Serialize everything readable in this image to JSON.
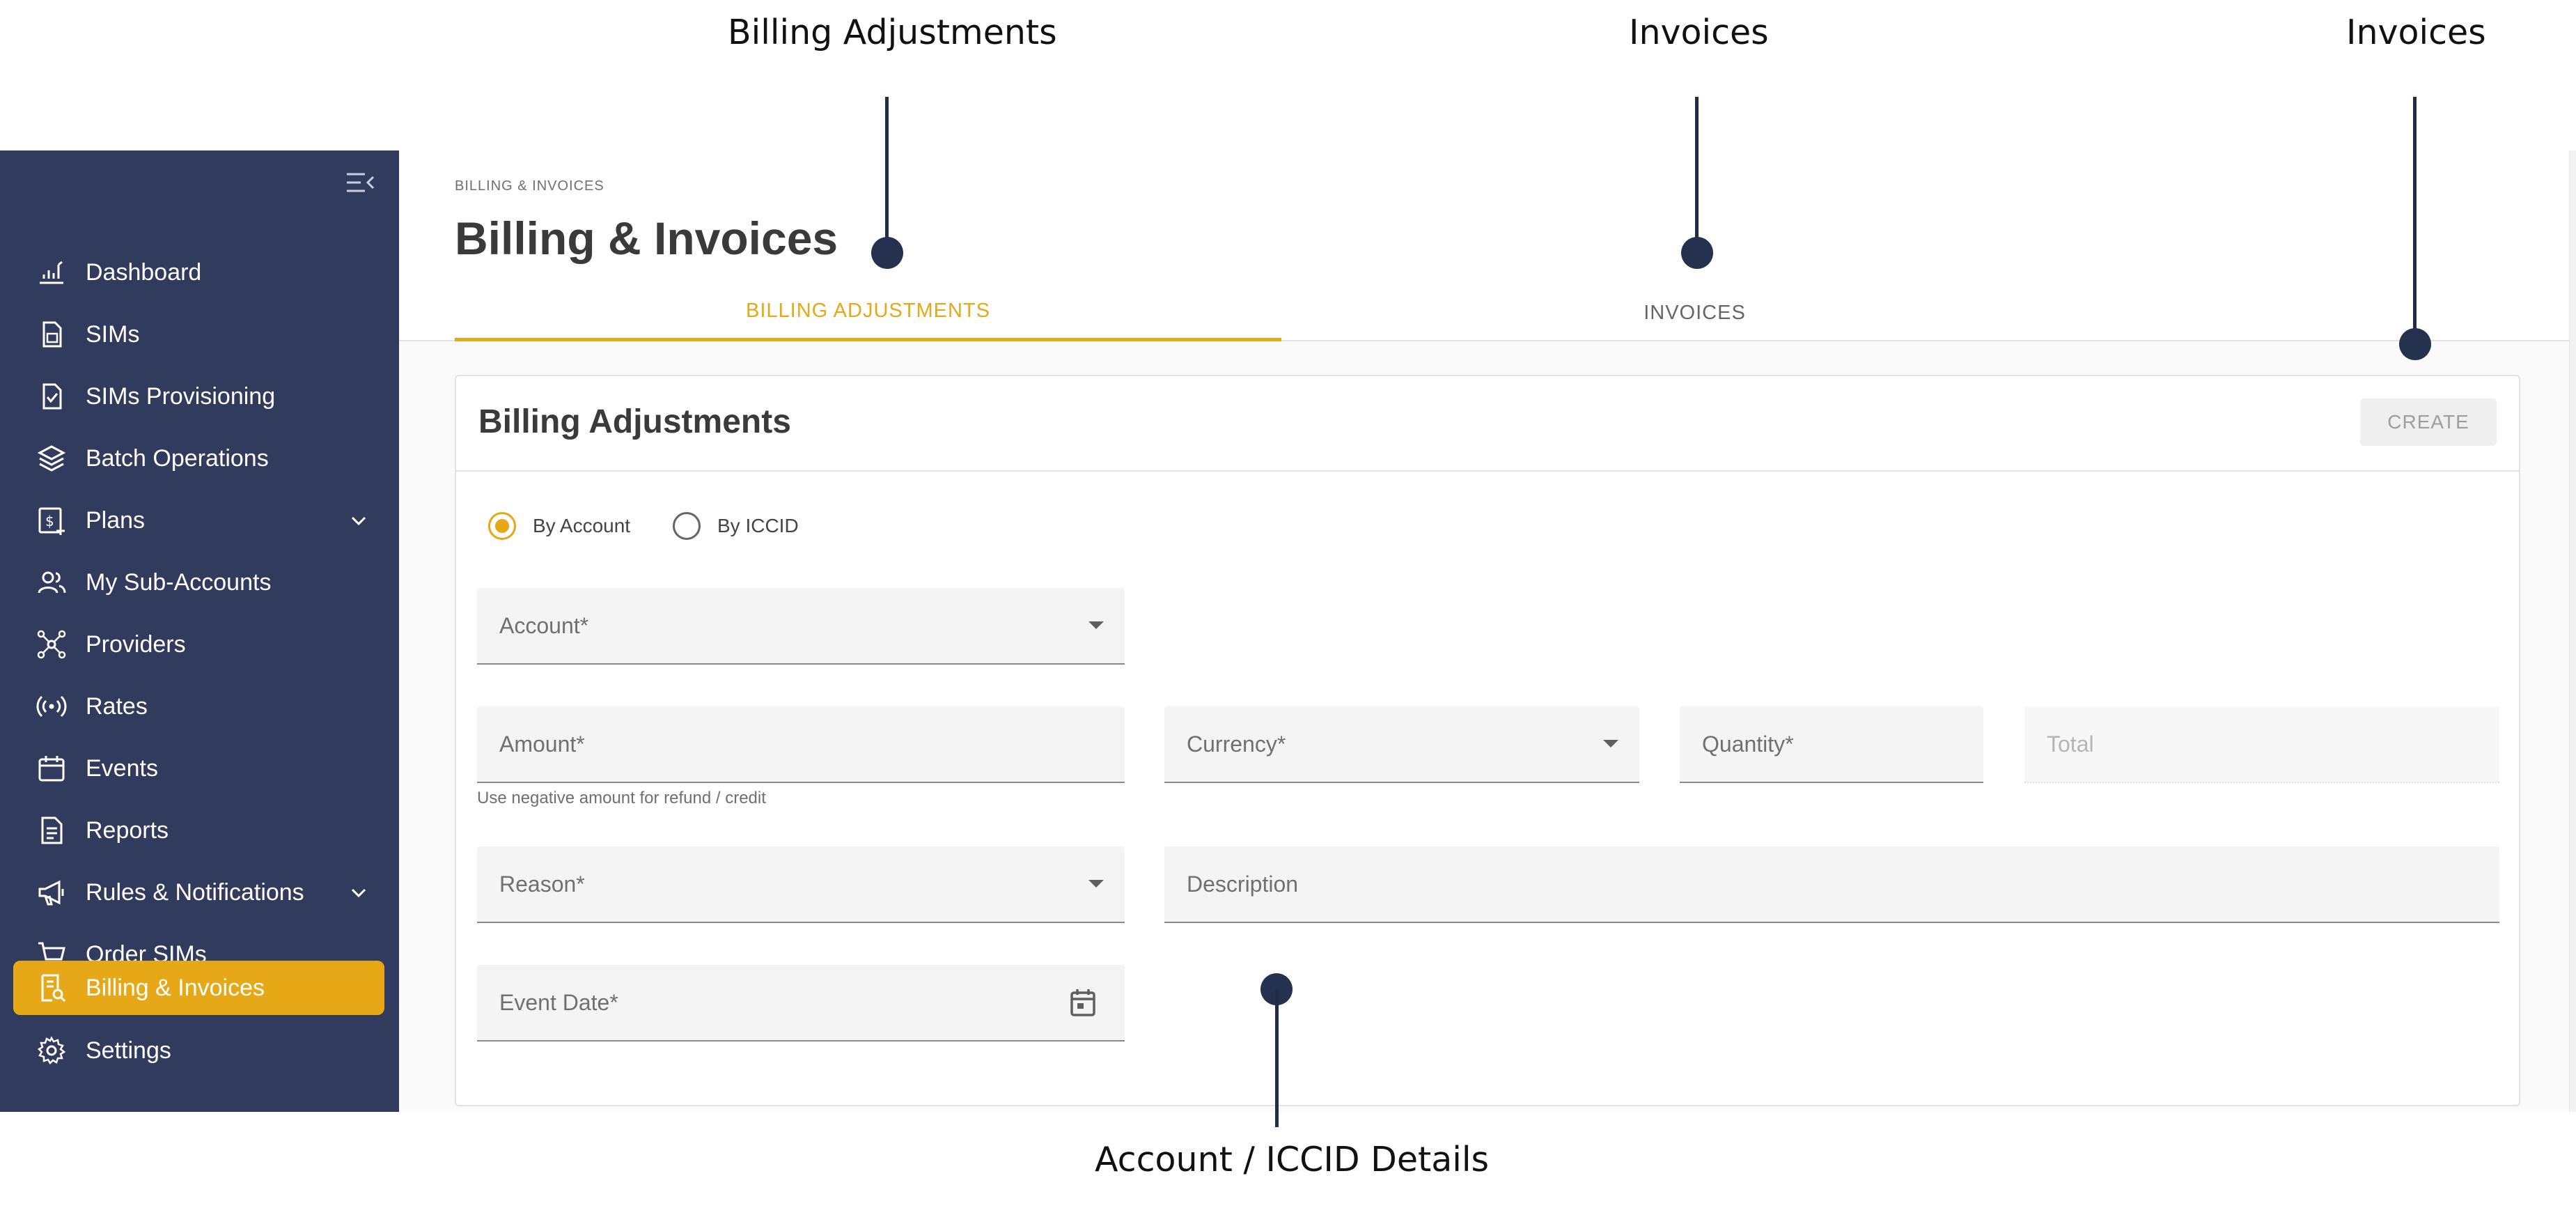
{
  "callouts": {
    "billing_adjustments": "Billing Adjustments",
    "invoices_tab": "Invoices",
    "invoices_create": "Invoices",
    "account_iccid_details": "Account / ICCID Details"
  },
  "sidebar": {
    "items": [
      {
        "label": "Dashboard",
        "icon": "dashboard-icon"
      },
      {
        "label": "SIMs",
        "icon": "sim-icon"
      },
      {
        "label": "SIMs Provisioning",
        "icon": "sim-provisioning-icon"
      },
      {
        "label": "Batch Operations",
        "icon": "layers-icon"
      },
      {
        "label": "Plans",
        "icon": "plans-icon",
        "expandable": true
      },
      {
        "label": "My Sub-Accounts",
        "icon": "users-icon"
      },
      {
        "label": "Providers",
        "icon": "network-icon"
      },
      {
        "label": "Rates",
        "icon": "broadcast-icon"
      },
      {
        "label": "Events",
        "icon": "calendar-icon"
      },
      {
        "label": "Reports",
        "icon": "report-icon"
      },
      {
        "label": "Rules & Notifications",
        "icon": "megaphone-icon",
        "expandable": true
      },
      {
        "label": "Order SIMs",
        "icon": "cart-icon"
      },
      {
        "label": "Billing & Invoices",
        "icon": "billing-icon",
        "active": true
      },
      {
        "label": "Settings",
        "icon": "gear-icon"
      }
    ]
  },
  "header": {
    "breadcrumb": "BILLING & INVOICES",
    "title": "Billing & Invoices",
    "tabs": [
      {
        "label": "BILLING ADJUSTMENTS",
        "active": true
      },
      {
        "label": "INVOICES",
        "active": false
      }
    ]
  },
  "card": {
    "title": "Billing Adjustments",
    "create_label": "CREATE",
    "radio": {
      "by_account": "By Account",
      "by_iccid": "By ICCID",
      "selected": "By Account"
    },
    "fields": {
      "account": "Account*",
      "amount": "Amount*",
      "amount_hint": "Use negative amount for refund / credit",
      "currency": "Currency*",
      "quantity": "Quantity*",
      "total": "Total",
      "reason": "Reason*",
      "description": "Description",
      "event_date": "Event Date*"
    }
  },
  "colors": {
    "sidebar_bg": "#313b5d",
    "accent": "#e6a817",
    "callout": "#24324f"
  }
}
